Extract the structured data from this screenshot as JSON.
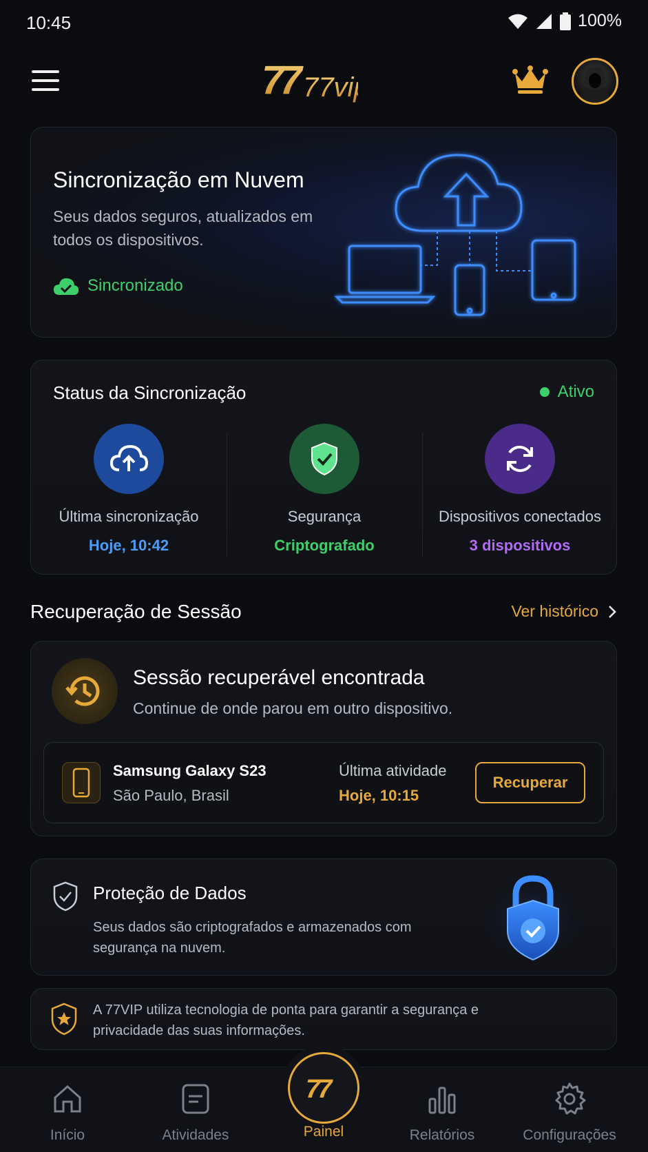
{
  "status_bar": {
    "time": "10:45",
    "battery": "100%"
  },
  "header": {
    "logo_text": "77vip"
  },
  "hero": {
    "title": "Sincronização em Nuvem",
    "subtitle": "Seus dados seguros, atualizados em todos os dispositivos.",
    "status": "Sincronizado"
  },
  "sync_status": {
    "title": "Status da Sincronização",
    "state": "Ativo",
    "items": [
      {
        "label": "Última sincronização",
        "value": "Hoje, 10:42",
        "color": "#4d9cf5"
      },
      {
        "label": "Segurança",
        "value": "Criptografado",
        "color": "#3ecf6b"
      },
      {
        "label": "Dispositivos conectados",
        "value": "3 dispositivos",
        "color": "#b06cf5"
      }
    ]
  },
  "session": {
    "section_title": "Recuperação de Sessão",
    "history_link": "Ver histórico",
    "title": "Sessão recuperável encontrada",
    "subtitle": "Continue de onde parou em outro dispositivo.",
    "device_name": "Samsung Galaxy S23",
    "device_location": "São Paulo, Brasil",
    "activity_label": "Última atividade",
    "activity_value": "Hoje, 10:15",
    "recover_button": "Recuperar"
  },
  "protection": {
    "title": "Proteção de Dados",
    "subtitle": "Seus dados são criptografados e armazenados com segurança na nuvem."
  },
  "info": {
    "text": "A 77VIP utiliza tecnologia de ponta para garantir a segurança e privacidade das suas informações."
  },
  "nav": {
    "items": [
      "Início",
      "Atividades",
      "Painel",
      "Relatórios",
      "Configurações"
    ],
    "center_logo": "77",
    "active": "Painel"
  },
  "colors": {
    "accent": "#e6a93a",
    "success": "#3ecf6b",
    "blue": "#4d9cf5",
    "purple": "#b06cf5"
  }
}
